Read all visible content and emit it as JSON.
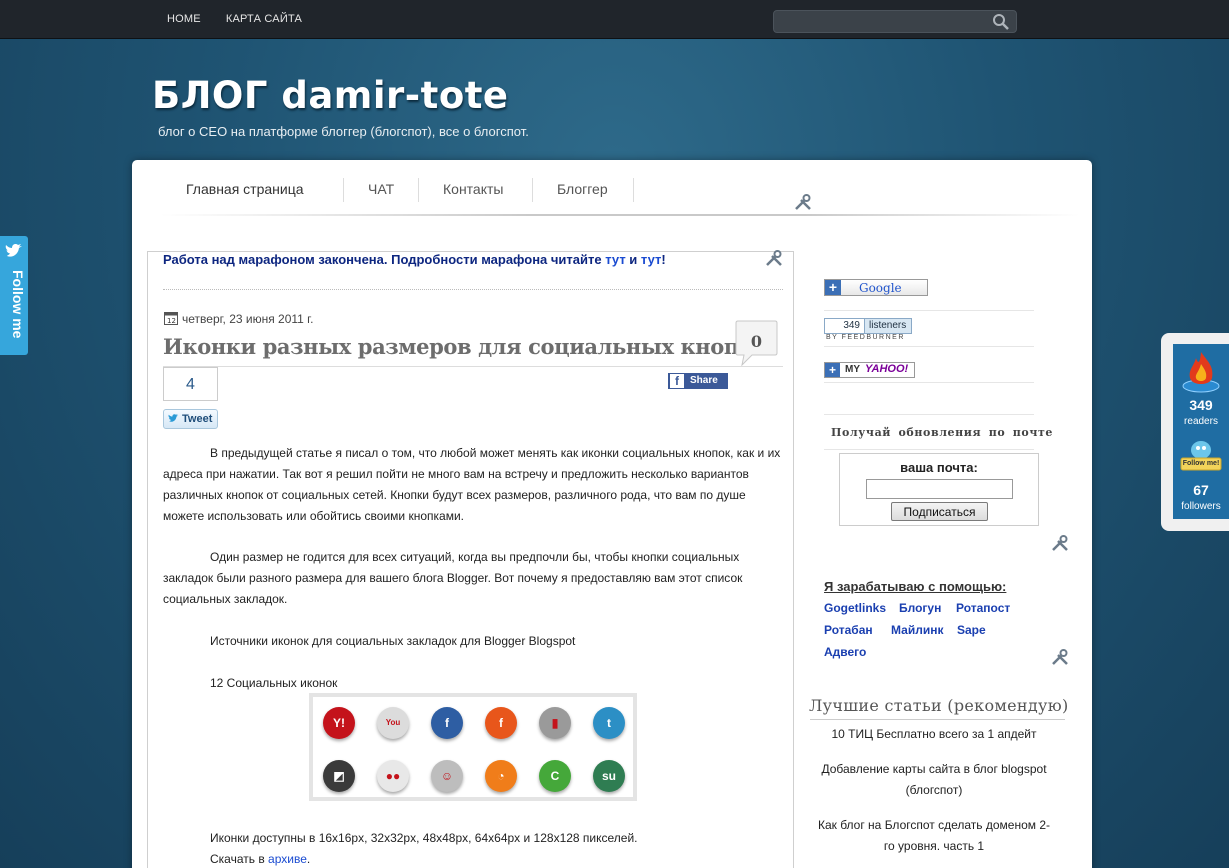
{
  "topnav": {
    "home": "HOME",
    "sitemap": "КАРТА САЙТА",
    "search_placeholder": ""
  },
  "header": {
    "title": "БЛОГ damir-tote",
    "description": "блог о СЕО на платформе блоггер (блогспот), все о блогспот."
  },
  "mainnav": [
    "Главная страница",
    "ЧАТ",
    "Контакты",
    "Блоггер"
  ],
  "announcement": {
    "text": "Работа над марафоном закончена. Подробности марафона читайте ",
    "link1": "тут",
    "and": " и ",
    "link2": "тут",
    "end": "!"
  },
  "post": {
    "date": "четверг, 23 июня 2011 г.",
    "title": "Иконки разных размеров для социальных кнопок",
    "comments": "0",
    "tweet_count": "4",
    "tweet_label": "Tweet",
    "share_label": "Share",
    "p1": "В предыдущей статье я писал о том, что любой может менять как иконки социальных кнопок, как и их адреса при нажатии. Так вот я решил пойти не много вам на встречу и предложить несколько вариантов различных кнопок от социальных сетей. Кнопки будут всех размеров, различного рода, что вам по душе можете использовать или обойтись своими кнопками.",
    "p2": "Один размер не годится для всех ситуаций, когда вы предпочли бы, чтобы кнопки социальных закладок были разного размера для вашего блога Blogger. Вот почему я предоставляю вам этот список социальных закладок.",
    "p3": "Источники иконок для социальных закладок для Blogger Blogspot",
    "p4": "12 Социальных иконок",
    "p5": "Иконки доступны в 16x16px, 32x32px, 48x48px, 64x64px и 128x128 пикселей.",
    "download_text": "Скачать в ",
    "download_link": "архиве",
    "download_end": "."
  },
  "social_icons": [
    {
      "name": "yahoo-icon",
      "glyph": "Y!",
      "color": "#c4131b"
    },
    {
      "name": "youtube-icon",
      "glyph": "You",
      "color": "#dcdcdc"
    },
    {
      "name": "facebook-icon",
      "glyph": "f",
      "color": "#2e5ea3"
    },
    {
      "name": "friendfeed-icon",
      "glyph": "f",
      "color": "#e8561b"
    },
    {
      "name": "digg-icon",
      "glyph": "▮",
      "color": "#9a9a9a"
    },
    {
      "name": "twitter-icon",
      "glyph": "t",
      "color": "#2c8fc5"
    },
    {
      "name": "delicious-icon",
      "glyph": "◩",
      "color": "#3a3a3a"
    },
    {
      "name": "flickr-icon",
      "glyph": "●●",
      "color": "#e8e8e8"
    },
    {
      "name": "reddit-icon",
      "glyph": "☺",
      "color": "#bdbdbd"
    },
    {
      "name": "rss-icon",
      "glyph": "◔",
      "color": "#f07d1a"
    },
    {
      "name": "technorati-icon",
      "glyph": "C",
      "color": "#45a83a"
    },
    {
      "name": "stumbleupon-icon",
      "glyph": "su",
      "color": "#2f7d52"
    }
  ],
  "sidebar": {
    "google_label": "Google",
    "feed_count": "349",
    "feed_label": "listeners",
    "feed_by": "BY FEEDBURNER",
    "my_label": "MY",
    "yahoo_label": "YAHOO!",
    "subscribe_head": "Получай обновления по почте",
    "subscribe_label": "ваша почта:",
    "subscribe_button": "Подписаться",
    "earn_head": "Я зарабатываю с помощью:",
    "earn_links": [
      "Gogetlinks",
      "Блогун",
      "Ротапост",
      "Ротабан",
      "Майлинк",
      "Sape",
      "Адвего"
    ],
    "best_head": "Лучшие статьи (рекомендую)",
    "best": [
      "10 ТИЦ Бесплатно всего за 1 апдейт",
      "Добавление карты сайта в блог blogspot (блогспот)",
      "Как блог на Блогспот сделать доменом 2-го уровня. часть 1"
    ]
  },
  "follow_tab": "Follow me",
  "feedjit": {
    "readers_count": "349",
    "readers_label": "readers",
    "followers_count": "67",
    "followers_label": "followers",
    "followme_badge": "Follow me!"
  },
  "colors": {
    "background": "#1f5473",
    "topbar": "#20252b",
    "link": "#1a4bd1",
    "announce": "#0d2680"
  }
}
